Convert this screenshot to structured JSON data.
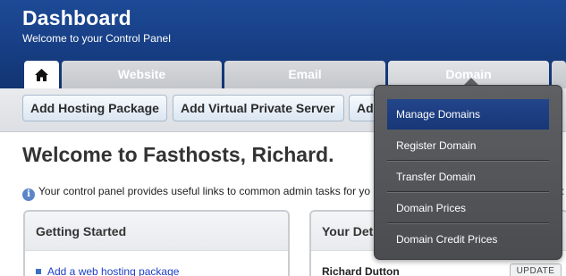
{
  "header": {
    "title": "Dashboard",
    "subtitle": "Welcome to your Control Panel"
  },
  "tabs": {
    "home_icon": "home-icon",
    "website": "Website",
    "email": "Email",
    "domain": "Domain"
  },
  "subnav": {
    "btn1": "Add Hosting Package",
    "btn2": "Add Virtual Private Server",
    "btn3": "Ad"
  },
  "main": {
    "welcome": "Welcome to Fasthosts, Richard.",
    "info_text": "Your control panel provides useful links to common admin tasks for yo",
    "info_icon": "i"
  },
  "panels": {
    "getting_started_title": "Getting Started",
    "getting_started_link": "Add a web hosting package",
    "your_details_title": "Your Det",
    "your_details_name": "Richard Dutton",
    "update_label": "UPDATE"
  },
  "domain_menu": {
    "items": [
      "Manage Domains",
      "Register Domain",
      "Transfer Domain",
      "Domain Prices",
      "Domain Credit Prices"
    ],
    "active_index": 0
  },
  "colors": {
    "header_blue": "#173e84",
    "menu_active": "#1e3f84",
    "menu_bg": "#555759",
    "link": "#1a3fc4"
  }
}
